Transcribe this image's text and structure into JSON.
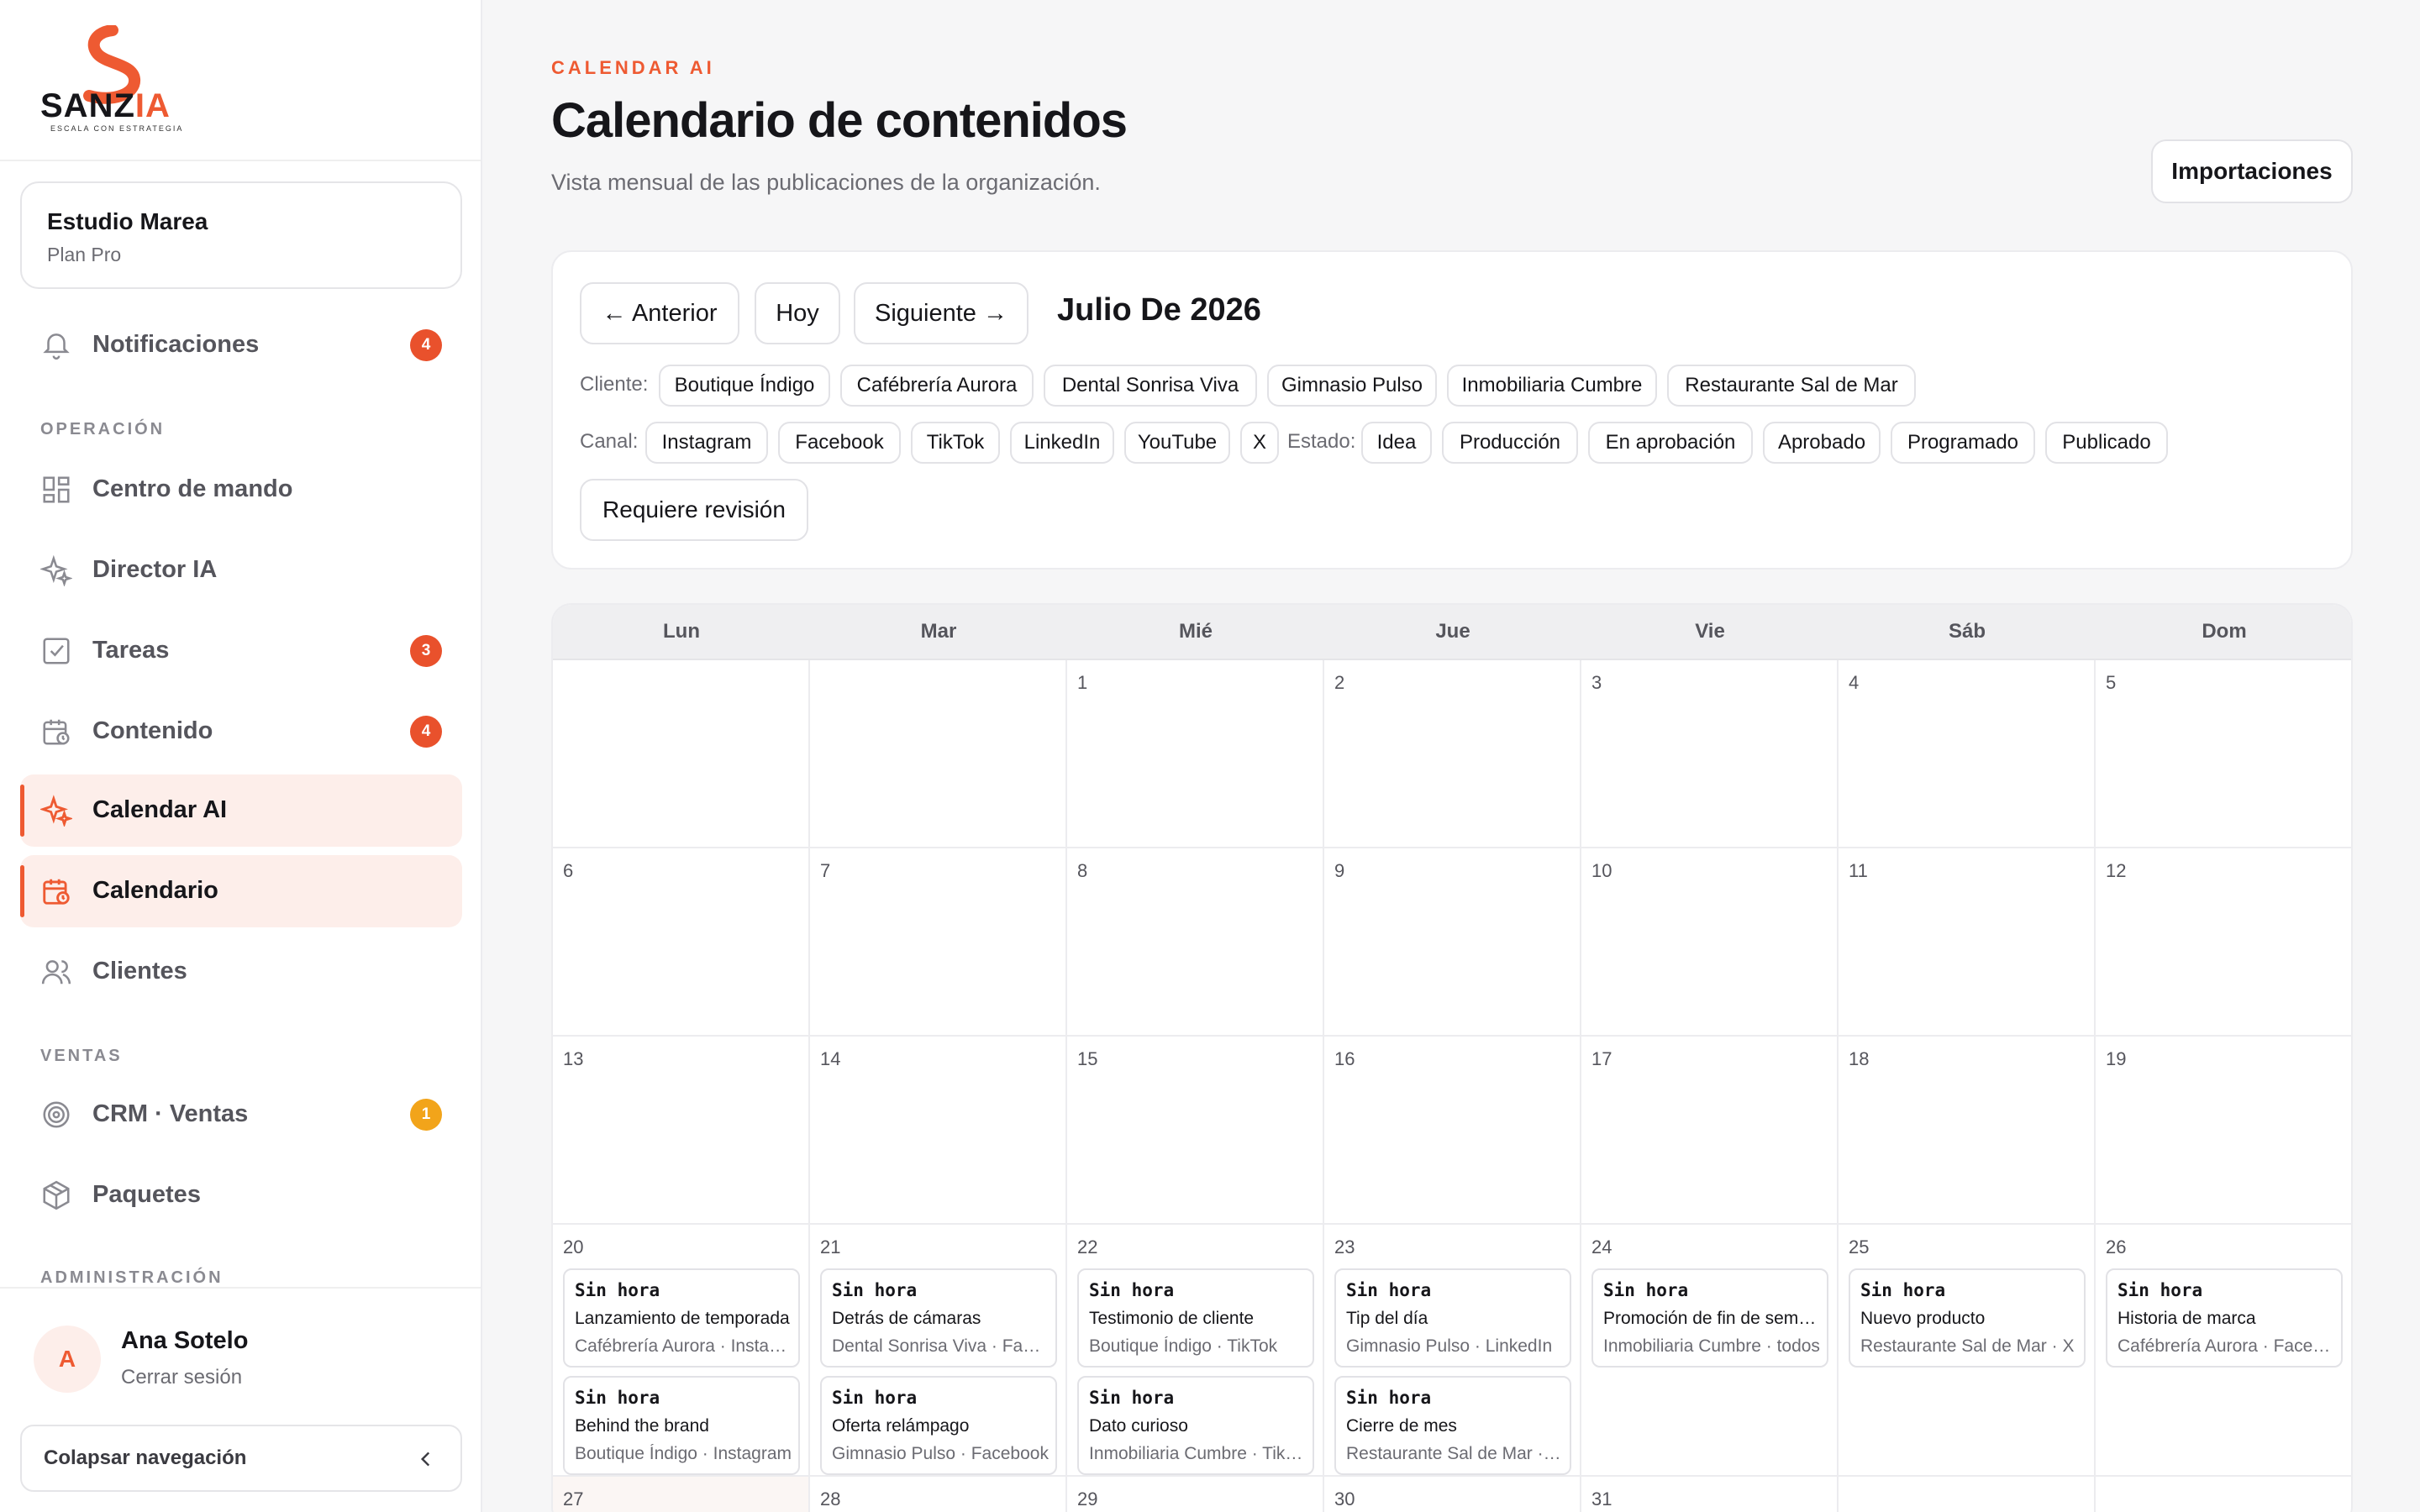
{
  "brand": {
    "name_main": "SANZ",
    "name_accent": "IA",
    "tagline": "ESCALA CON ESTRATEGIA",
    "accent_color": "#ee5a32"
  },
  "org": {
    "name": "Estudio Marea",
    "plan": "Plan Pro"
  },
  "nav": {
    "notifications": {
      "label": "Notificaciones",
      "badge": "4",
      "icon": "bell-icon"
    },
    "section_operation": "OPERACIÓN",
    "command_center": {
      "label": "Centro de mando",
      "icon": "grid-icon"
    },
    "director_ai": {
      "label": "Director IA",
      "icon": "sparkles-icon"
    },
    "tasks": {
      "label": "Tareas",
      "badge": "3",
      "icon": "checkbox-icon"
    },
    "content": {
      "label": "Contenido",
      "badge": "4",
      "icon": "calendar-clock-icon"
    },
    "calendar_ai": {
      "label": "Calendar AI",
      "icon": "sparkles-icon"
    },
    "calendar": {
      "label": "Calendario",
      "icon": "calendar-clock-icon"
    },
    "clients": {
      "label": "Clientes",
      "icon": "users-icon"
    },
    "section_sales": "VENTAS",
    "crm": {
      "label": "CRM · Ventas",
      "badge": "1",
      "icon": "target-icon"
    },
    "packages": {
      "label": "Paquetes",
      "icon": "package-icon"
    },
    "section_admin": "ADMINISTRACIÓN"
  },
  "user": {
    "initial": "A",
    "name": "Ana Sotelo",
    "logout": "Cerrar sesión"
  },
  "collapse_label": "Colapsar navegación",
  "header": {
    "eyebrow": "CALENDAR AI",
    "title": "Calendario de contenidos",
    "subtitle": "Vista mensual de las publicaciones de la organización.",
    "imports_button": "Importaciones"
  },
  "toolbar": {
    "prev": "← Anterior",
    "today": "Hoy",
    "next": "Siguiente →",
    "month": "Julio De 2026",
    "client_label": "Cliente:",
    "clients": [
      "Boutique Índigo",
      "Cafébrería Aurora",
      "Dental Sonrisa Viva",
      "Gimnasio Pulso",
      "Inmobiliaria Cumbre",
      "Restaurante Sal de Mar"
    ],
    "channel_label": "Canal:",
    "channels": [
      "Instagram",
      "Facebook",
      "TikTok",
      "LinkedIn",
      "YouTube",
      "X"
    ],
    "status_label": "Estado:",
    "statuses": [
      "Idea",
      "Producción",
      "En aprobación",
      "Aprobado",
      "Programado",
      "Publicado"
    ],
    "review_button": "Requiere revisión"
  },
  "calendar": {
    "weekdays": [
      "Lun",
      "Mar",
      "Mié",
      "Jue",
      "Vie",
      "Sáb",
      "Dom"
    ],
    "weeks": [
      [
        "",
        "",
        "1",
        "2",
        "3",
        "4",
        "5"
      ],
      [
        "6",
        "7",
        "8",
        "9",
        "10",
        "11",
        "12"
      ],
      [
        "13",
        "14",
        "15",
        "16",
        "17",
        "18",
        "19"
      ],
      [
        "20",
        "21",
        "22",
        "23",
        "24",
        "25",
        "26"
      ]
    ],
    "next_week": [
      "27",
      "28",
      "29",
      "30",
      "31",
      "",
      ""
    ],
    "events": {
      "20": [
        {
          "time": "Sin hora",
          "title": "Lanzamiento de temporada",
          "meta": "Cafébrería Aurora · Instagram"
        },
        {
          "time": "Sin hora",
          "title": "Behind the brand",
          "meta": "Boutique Índigo · Instagram"
        }
      ],
      "21": [
        {
          "time": "Sin hora",
          "title": "Detrás de cámaras",
          "meta": "Dental Sonrisa Viva · Facebook"
        },
        {
          "time": "Sin hora",
          "title": "Oferta relámpago",
          "meta": "Gimnasio Pulso · Facebook"
        }
      ],
      "22": [
        {
          "time": "Sin hora",
          "title": "Testimonio de cliente",
          "meta": "Boutique Índigo · TikTok"
        },
        {
          "time": "Sin hora",
          "title": "Dato curioso",
          "meta": "Inmobiliaria Cumbre · TikTok"
        }
      ],
      "23": [
        {
          "time": "Sin hora",
          "title": "Tip del día",
          "meta": "Gimnasio Pulso · LinkedIn"
        },
        {
          "time": "Sin hora",
          "title": "Cierre de mes",
          "meta": "Restaurante Sal de Mar · LinkedIn"
        }
      ],
      "24": [
        {
          "time": "Sin hora",
          "title": "Promoción de fin de semana",
          "meta": "Inmobiliaria Cumbre · todos"
        }
      ],
      "25": [
        {
          "time": "Sin hora",
          "title": "Nuevo producto",
          "meta": "Restaurante Sal de Mar · X"
        }
      ],
      "26": [
        {
          "time": "Sin hora",
          "title": "Historia de marca",
          "meta": "Cafébrería Aurora · Facebook"
        }
      ]
    }
  }
}
